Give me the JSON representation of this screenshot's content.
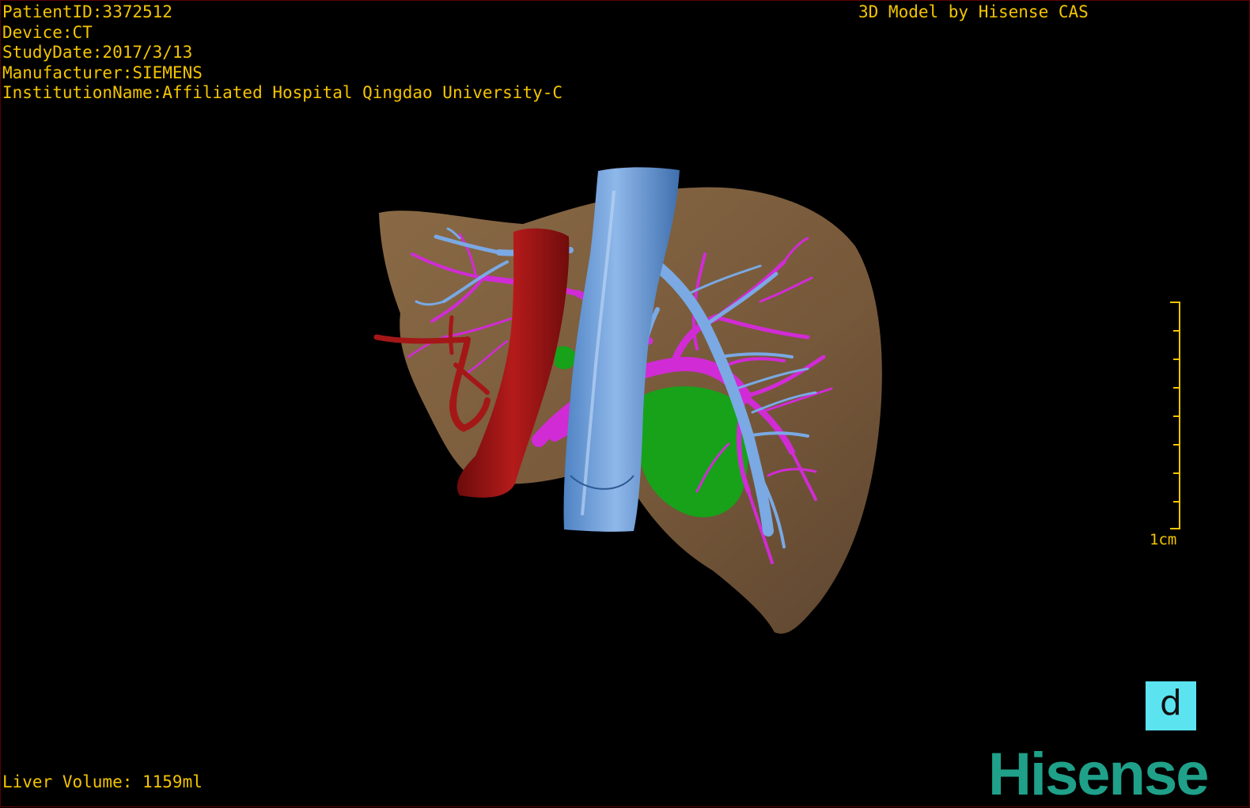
{
  "header": {
    "patient_id": "PatientID:3372512",
    "device": "Device:CT",
    "study_date": "StudyDate:2017/3/13",
    "manufacturer": "Manufacturer:SIEMENS",
    "institution": "InstitutionName:Affiliated Hospital Qingdao University-C"
  },
  "brand_caption": "3D Model by Hisense CAS",
  "footer": {
    "liver_volume": "Liver Volume: 1159ml"
  },
  "scale": {
    "label": "1cm"
  },
  "orientation_button": {
    "label": "d"
  },
  "logo": {
    "text": "Hisense"
  },
  "colors": {
    "text": "#f4c400",
    "liver": "#7e5f3b",
    "portal_vein": "#d12bd6",
    "hepatic_vein": "#6b9bd8",
    "artery": "#9c1414",
    "lesion": "#17a21a",
    "logo": "#1fa089",
    "orientation_bg": "#5ce3f0"
  },
  "icons": {
    "orientation": "orientation-cube-icon",
    "logo": "hisense-logo-icon"
  }
}
